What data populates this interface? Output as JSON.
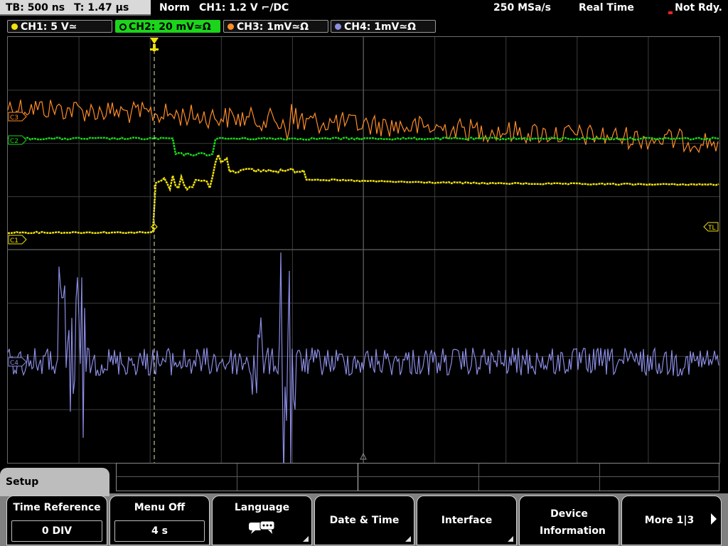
{
  "status_bar": {
    "timebase": "TB: 500 ns",
    "trigger_pos": "T: 1.47 µs",
    "trigger_mode": "Norm",
    "trigger_info": "CH1: 1.2 V ⌐/DC",
    "sample_rate": "250 MSa/s",
    "acq_mode": "Real Time",
    "status": "Not Rdy."
  },
  "channels": [
    {
      "label": "CH1: 5 V≃",
      "color": "#f0e20f",
      "active": false
    },
    {
      "label": "CH2: 20 mV≃Ω",
      "color": "#1bd51b",
      "active": true
    },
    {
      "label": "CH3: 1mV≃Ω",
      "color": "#ff8c28",
      "active": false
    },
    {
      "label": "CH4: 1mV≃Ω",
      "color": "#8b8ce3",
      "active": false
    }
  ],
  "markers": {
    "c1": "C1",
    "c2": "C2",
    "c3": "C3",
    "c4": "C4",
    "trigger_level": "TL"
  },
  "menu": {
    "title": "Setup",
    "buttons": [
      {
        "label": "Time Reference",
        "value": "0 DIV"
      },
      {
        "label": "Menu Off",
        "value": "4 s"
      },
      {
        "label": "Language"
      },
      {
        "label": "Date & Time"
      },
      {
        "label": "Interface"
      },
      {
        "label": "Device Information"
      },
      {
        "label": "More 1|3"
      }
    ]
  },
  "colors": {
    "ch1": "#f0e20f",
    "ch2": "#1bd51b",
    "ch3": "#ff8c28",
    "ch4": "#8b8ce3",
    "grid": "#5a5a5a",
    "menu_bg": "#808080"
  }
}
